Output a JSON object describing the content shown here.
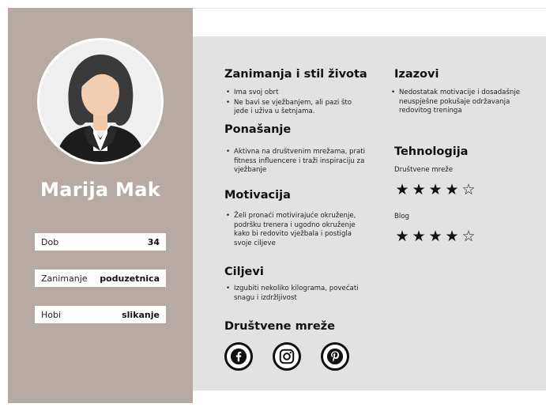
{
  "profile": {
    "name": "Marija Mak",
    "info": [
      {
        "label": "Dob",
        "value": "34"
      },
      {
        "label": "Zanimanje",
        "value": "poduzetnica"
      },
      {
        "label": "Hobi",
        "value": "slikanje"
      }
    ]
  },
  "sections": {
    "lifestyle": {
      "title": "Zanimanja i stil života",
      "items": [
        "Ima svoj obrt",
        "Ne bavi se vježbanjem, ali pazi što jede i uživa u šetnjama."
      ]
    },
    "behavior": {
      "title": "Ponašanje",
      "items": [
        "Aktivna na društvenim mrežama, prati fitness influencere i traži inspiraciju za vježbanje"
      ]
    },
    "motivation": {
      "title": "Motivacija",
      "items": [
        "Želi pronaći motivirajuće okruženje, podršku trenera i ugodno okruženje kako bi redovito vježbala i postigla svoje ciljeve"
      ]
    },
    "goals": {
      "title": "Ciljevi",
      "items": [
        "Izgubiti nekoliko kilograma, povećati snagu i izdržljivost"
      ]
    },
    "challenges": {
      "title": "Izazovi",
      "items": [
        "Nedostatak motivacije i dosadašnje neuspješne pokušaje održavanja redovitog treninga"
      ]
    },
    "technology": {
      "title": "Tehnologija",
      "ratings": [
        {
          "label": "Društvene mreže",
          "rating": 4,
          "max": 5
        },
        {
          "label": "Blog",
          "rating": 4,
          "max": 5
        }
      ]
    },
    "social": {
      "title": "Društvene mreže",
      "icons": [
        "facebook-icon",
        "instagram-icon",
        "pinterest-icon"
      ]
    }
  },
  "colors": {
    "sidebar": "#b7aaa4",
    "main_bg": "#e2e2e2",
    "text": "#111111"
  }
}
